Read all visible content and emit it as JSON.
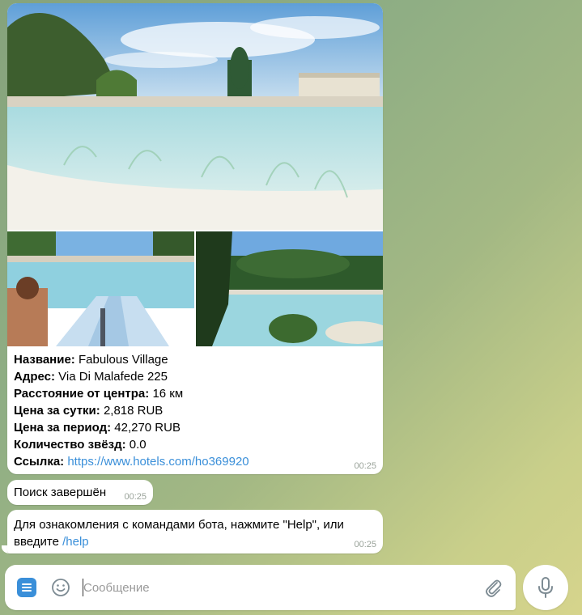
{
  "album": {
    "photos": [
      {
        "description": "resort-pool-main"
      },
      {
        "description": "water-slide-pool"
      },
      {
        "description": "lagoon-pool-pines"
      }
    ],
    "caption": {
      "name_label": "Название:",
      "name_value": "Fabulous Village",
      "address_label": "Адрес:",
      "address_value": "Via Di Malafede 225",
      "distance_label": "Расстояние от центра:",
      "distance_value": "16 км",
      "price_day_label": "Цена за сутки:",
      "price_day_value": "2,818 RUB",
      "price_period_label": "Цена за период:",
      "price_period_value": "42,270 RUB",
      "stars_label": "Количество звёзд:",
      "stars_value": "0.0",
      "link_label": "Ссылка:",
      "link_value": "https://www.hotels.com/ho369920"
    },
    "time": "00:25"
  },
  "search_done": {
    "text": "Поиск завершён",
    "time": "00:25"
  },
  "help_message": {
    "text": "Для ознакомления с командами бота, нажмите \"Help\", или введите ",
    "command": "/help",
    "time": "00:25"
  },
  "composer": {
    "placeholder": "Сообщение",
    "menu_icon": "menu-icon",
    "emoji_icon": "smile-icon",
    "attach_icon": "paperclip-icon",
    "mic_icon": "microphone-icon"
  },
  "colors": {
    "link": "#3a8fd9",
    "accent": "#3a8fd9",
    "bubble": "#ffffff"
  }
}
